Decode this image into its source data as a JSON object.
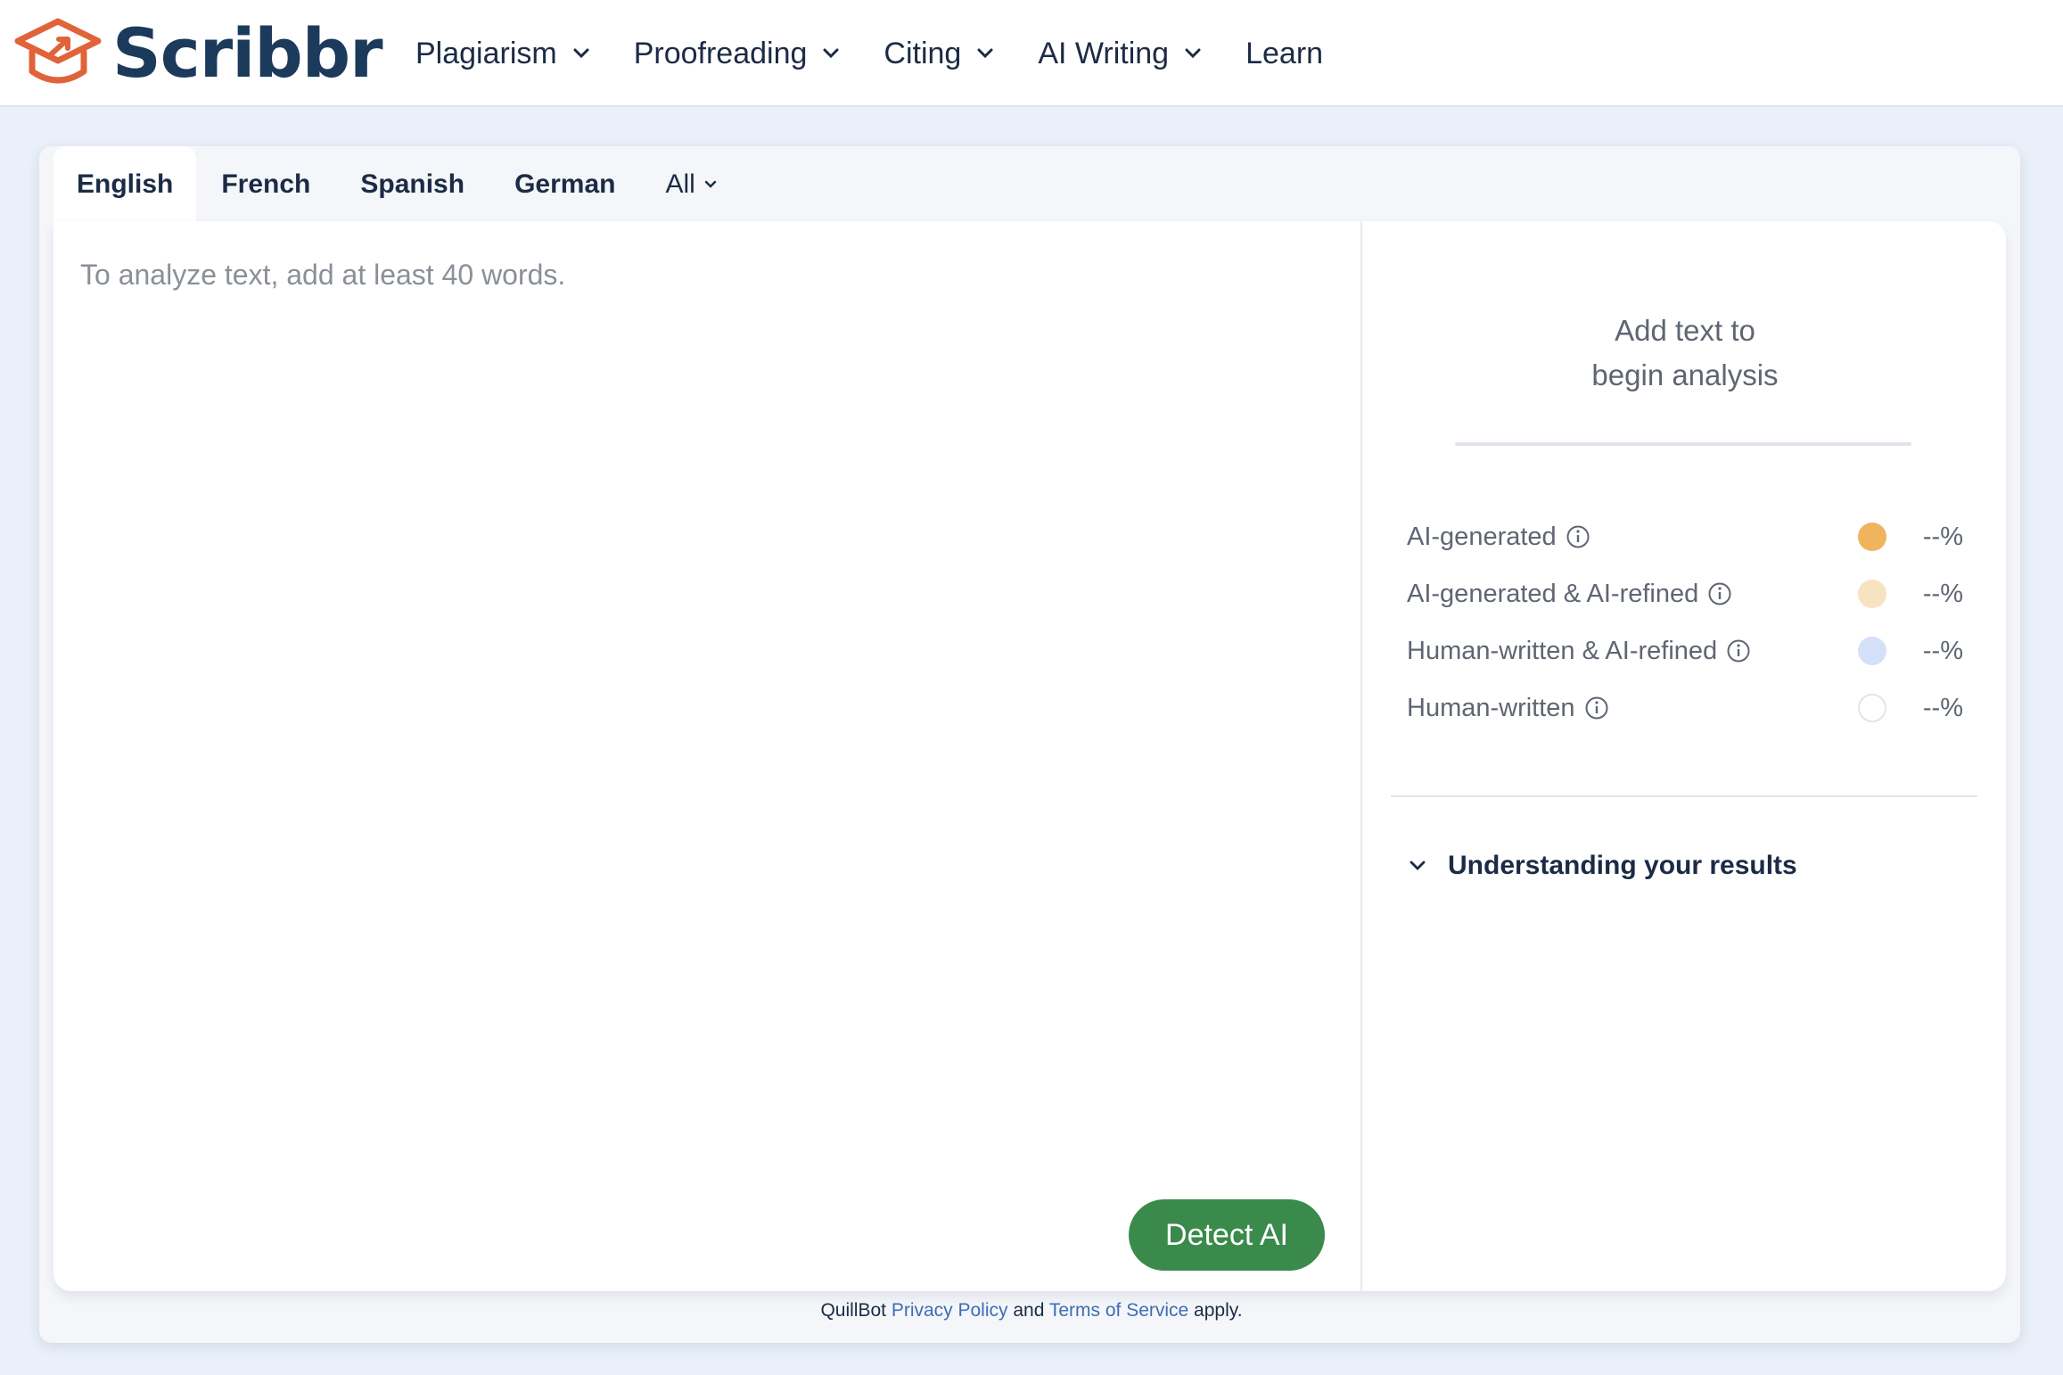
{
  "navbar": {
    "logo_text": "Scribbr",
    "items": [
      {
        "label": "Plagiarism",
        "has_dropdown": true
      },
      {
        "label": "Proofreading",
        "has_dropdown": true
      },
      {
        "label": "Citing",
        "has_dropdown": true
      },
      {
        "label": "AI Writing",
        "has_dropdown": true
      },
      {
        "label": "Learn",
        "has_dropdown": false
      }
    ]
  },
  "tabs": [
    {
      "label": "English",
      "active": true
    },
    {
      "label": "French",
      "active": false
    },
    {
      "label": "Spanish",
      "active": false
    },
    {
      "label": "German",
      "active": false
    },
    {
      "label": "All",
      "active": false
    }
  ],
  "editor": {
    "placeholder": "To analyze text, add at least 40 words.",
    "value": ""
  },
  "detect_button": {
    "label": "Detect AI",
    "color": "#3a8a4c"
  },
  "results": {
    "title_line1": "Add text to",
    "title_line2": "begin analysis",
    "categories": [
      {
        "label": "AI-generated",
        "value": "--%",
        "color": "#f0b45d"
      },
      {
        "label": "AI-generated & AI-refined",
        "value": "--%",
        "color": "#f7e2c2"
      },
      {
        "label": "Human-written & AI-refined",
        "value": "--%",
        "color": "#d4e1f8"
      },
      {
        "label": "Human-written",
        "value": "--%",
        "color": "#ffffff"
      }
    ],
    "understanding_label": "Understanding your results"
  },
  "footer": {
    "prefix": "QuillBot ",
    "privacy_link": "Privacy Policy",
    "and_text": " and ",
    "terms_link": "Terms of Service",
    "suffix": " apply."
  },
  "colors": {
    "brand_navy": "#1b3a5c",
    "logo_orange": "#e0633a",
    "link_blue": "#3d6db5"
  }
}
